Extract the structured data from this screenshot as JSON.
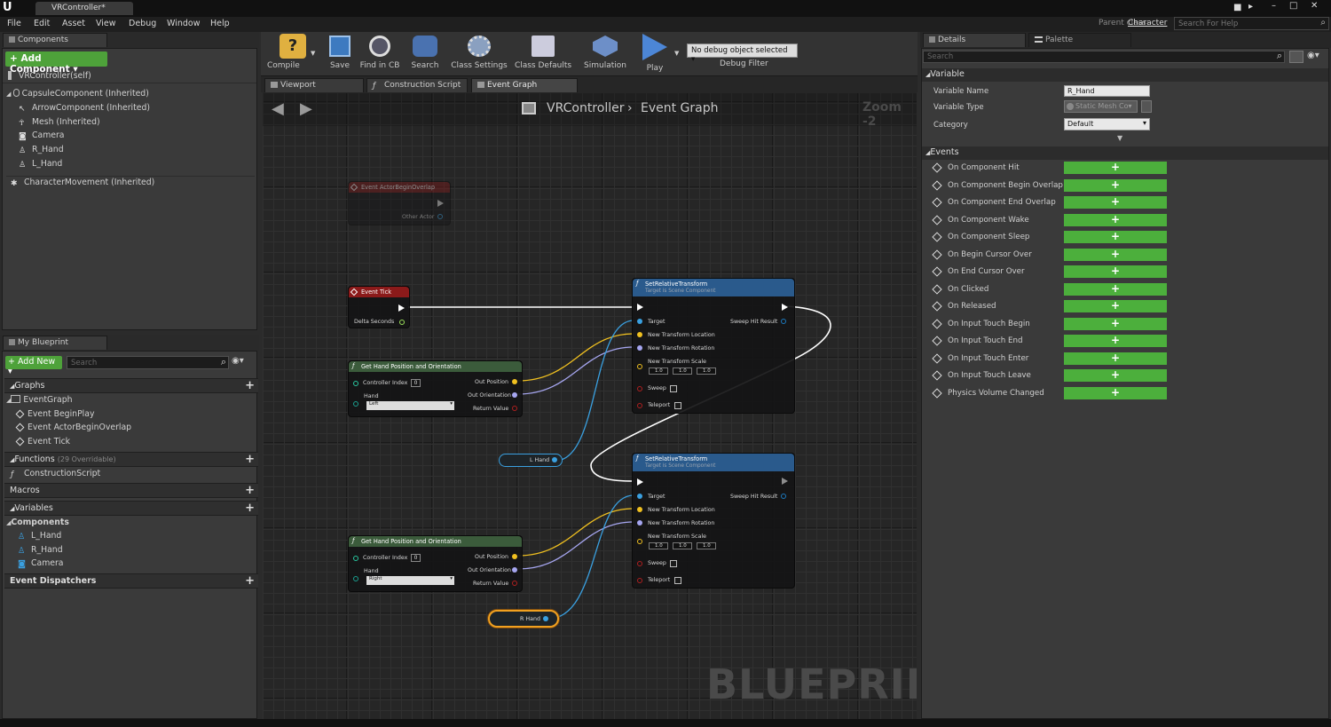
{
  "title_bar": {
    "tab": "VRController*",
    "parent_class_label": "Parent class:",
    "parent_class_value": "Character",
    "search_help_placeholder": "Search For Help"
  },
  "menu": [
    "File",
    "Edit",
    "Asset",
    "View",
    "Debug",
    "Window",
    "Help"
  ],
  "components": {
    "tab": "Components",
    "add_button": "+ Add Component ▾",
    "root": "VRController(self)",
    "items": [
      "CapsuleComponent (Inherited)",
      "ArrowComponent (Inherited)",
      "Mesh (Inherited)",
      "Camera",
      "R_Hand",
      "L_Hand",
      "CharacterMovement (Inherited)"
    ]
  },
  "my_blueprint": {
    "tab": "My Blueprint",
    "add_new": "+ Add New ▾",
    "search_placeholder": "Search",
    "graphs_label": "Graphs",
    "graph": "EventGraph",
    "events": [
      "Event BeginPlay",
      "Event ActorBeginOverlap",
      "Event Tick"
    ],
    "functions_label": "Functions",
    "functions_count": "(29 Overridable)",
    "function": "ConstructionScript",
    "macros_label": "Macros",
    "variables_label": "Variables",
    "components_label": "Components",
    "component_vars": [
      "L_Hand",
      "R_Hand",
      "Camera"
    ],
    "dispatchers_label": "Event Dispatchers"
  },
  "toolbar": [
    "Compile",
    "Save",
    "Find in CB",
    "Search",
    "Class Settings",
    "Class Defaults",
    "Simulation",
    "Play"
  ],
  "debug": {
    "selector": "No debug object selected ▾",
    "filter": "Debug Filter"
  },
  "editor_tabs": [
    "Viewport",
    "Construction Script",
    "Event Graph"
  ],
  "graph": {
    "breadcrumb_class": "VRController",
    "breadcrumb_sep": "›",
    "breadcrumb_graph": "Event Graph",
    "zoom": "Zoom -2",
    "watermark": "BLUEPRINT",
    "nodes": {
      "overlap": {
        "title": "Event ActorBeginOverlap",
        "pin": "Other Actor"
      },
      "tick": {
        "title": "Event Tick",
        "pin": "Delta Seconds"
      },
      "get1": {
        "title": "Get Hand Position and Orientation",
        "ci": "Controller Index",
        "ci_val": "0",
        "hand": "Hand",
        "hand_val": "Left",
        "op": "Out Position",
        "oo": "Out Orientation",
        "rv": "Return Value"
      },
      "get2": {
        "title": "Get Hand Position and Orientation",
        "ci": "Controller Index",
        "ci_val": "0",
        "hand": "Hand",
        "hand_val": "Right",
        "op": "Out Position",
        "oo": "Out Orientation",
        "rv": "Return Value"
      },
      "set1": {
        "title": "SetRelativeTransform",
        "sub": "Target is Scene Component",
        "target": "Target",
        "loc": "New Transform Location",
        "rot": "New Transform Rotation",
        "scale": "New Transform Scale",
        "sx": "1.0",
        "sy": "1.0",
        "sz": "1.0",
        "sweep": "Sweep",
        "teleport": "Teleport",
        "hit": "Sweep Hit Result"
      },
      "set2": {
        "title": "SetRelativeTransform",
        "sub": "Target is Scene Component",
        "target": "Target",
        "loc": "New Transform Location",
        "rot": "New Transform Rotation",
        "scale": "New Transform Scale",
        "sx": "1.0",
        "sy": "1.0",
        "sz": "1.0",
        "sweep": "Sweep",
        "teleport": "Teleport",
        "hit": "Sweep Hit Result"
      },
      "lhand": "L Hand",
      "rhand": "R Hand"
    }
  },
  "details": {
    "tab": "Details",
    "palette_tab": "Palette",
    "search_placeholder": "Search",
    "variable_section": "Variable",
    "var_name_label": "Variable Name",
    "var_name": "R_Hand",
    "var_type_label": "Variable Type",
    "var_type": "Static Mesh Co▾",
    "category_label": "Category",
    "category": "Default",
    "events_section": "Events",
    "events": [
      "On Component Hit",
      "On Component Begin Overlap",
      "On Component End Overlap",
      "On Component Wake",
      "On Component Sleep",
      "On Begin Cursor Over",
      "On End Cursor Over",
      "On Clicked",
      "On Released",
      "On Input Touch Begin",
      "On Input Touch End",
      "On Input Touch Enter",
      "On Input Touch Leave",
      "Physics Volume Changed"
    ],
    "add": "+"
  },
  "colors": {
    "add_green": "#4ea23a",
    "event_red": "#8b1a1a",
    "function_blue": "#2a5a8c",
    "exec": "#ffffff",
    "vector": "#f0c020",
    "rotator": "#a6a6f0",
    "object": "#3aa0e0"
  }
}
